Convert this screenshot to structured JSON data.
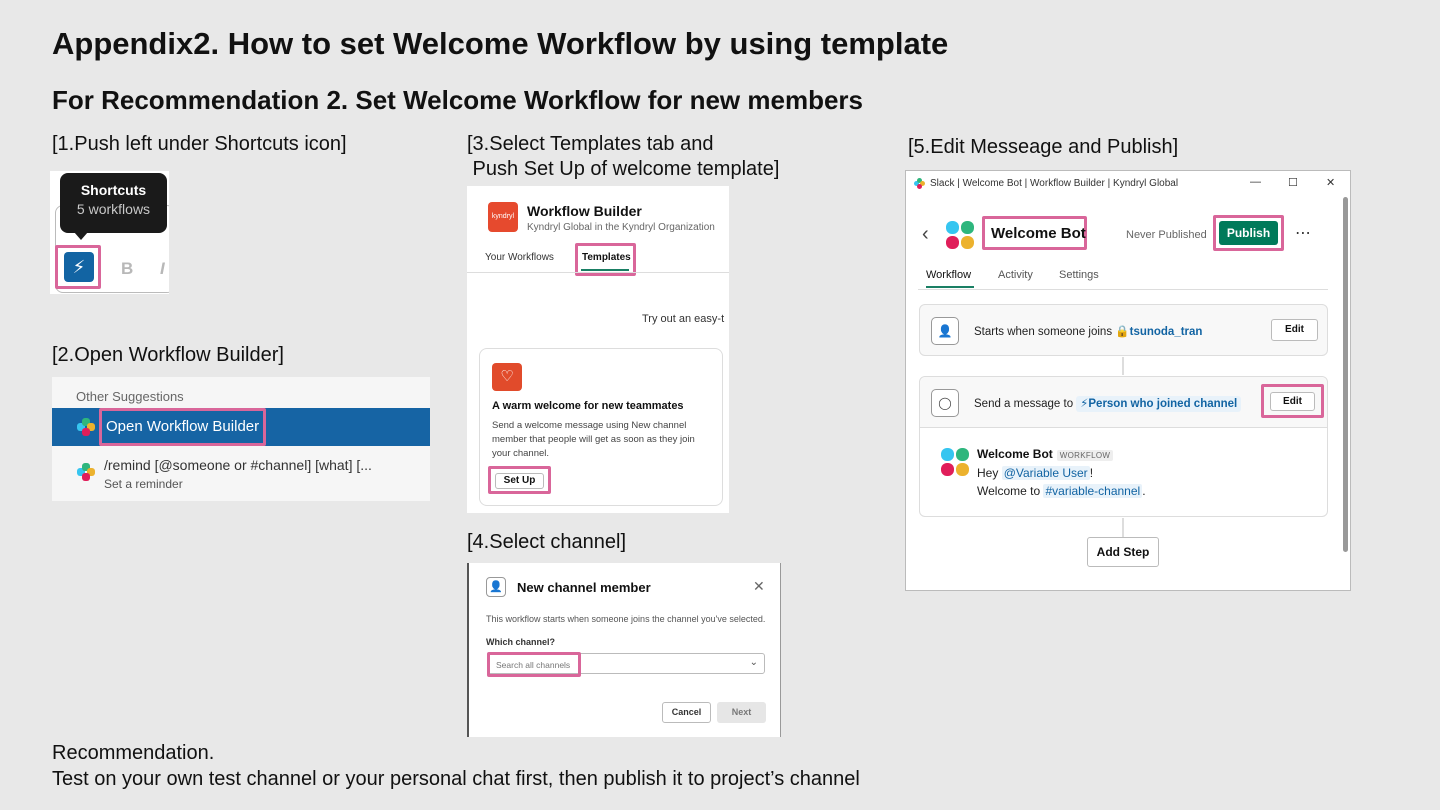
{
  "title": "Appendix2. How to set Welcome Workflow by using template",
  "subtitle": "For Recommendation 2. Set Welcome Workflow for new members",
  "steps": {
    "s1": "[1.Push left under Shortcuts icon]",
    "s2": "[2.Open Workflow Builder]",
    "s3_line1": "[3.Select Templates tab and",
    "s3_line2": " Push Set Up of welcome template]",
    "s4": "[4.Select channel]",
    "s5": "[5.Edit Messeage and Publish]"
  },
  "shot1": {
    "tooltip_title": "Shortcuts",
    "tooltip_sub": "5 workflows",
    "bold_glyph": "B",
    "italic_glyph": "I"
  },
  "shot2": {
    "section": "Other Suggestions",
    "item1": "Open Workflow Builder",
    "item2_cmd": "/remind [@someone or #channel] [what] [...",
    "item2_sub": "Set a reminder"
  },
  "shot3": {
    "logo_text": "kyndryl",
    "title": "Workflow Builder",
    "org": "Kyndryl Global in the Kyndryl Organization",
    "tab_your": "Your Workflows",
    "tab_templates": "Templates",
    "try_text": "Try out an easy-t",
    "card_title": "A warm welcome for new teammates",
    "card_desc": "Send a welcome message using New channel member that people will get as soon as they join your channel.",
    "setup": "Set Up"
  },
  "shot4": {
    "title": "New channel member",
    "desc": "This workflow starts when someone joins the channel you've selected.",
    "which": "Which channel?",
    "placeholder": "Search all channels",
    "cancel": "Cancel",
    "next": "Next"
  },
  "shot5": {
    "window_title": "Slack | Welcome Bot | Workflow Builder | Kyndryl Global",
    "name": "Welcome Bot",
    "status": "Never Published",
    "publish": "Publish",
    "tabs": [
      "Workflow",
      "Activity",
      "Settings"
    ],
    "trigger_text": "Starts when someone joins",
    "trigger_channel": "tsunoda_tran",
    "edit": "Edit",
    "send_text": "Send a message to",
    "send_target": "Person who joined channel",
    "msg_name": "Welcome Bot",
    "msg_badge": "WORKFLOW",
    "msg_line1_a": "Hey ",
    "msg_line1_var": "@Variable User",
    "msg_line1_b": "!",
    "msg_line2_a": "Welcome to ",
    "msg_line2_var": "#variable-channel",
    "msg_line2_b": ".",
    "add_step": "Add Step"
  },
  "footer": {
    "line1": "Recommendation.",
    "line2": "Test on your own test channel or your personal chat first, then publish it to project’s channel"
  },
  "colors": {
    "background": "#e8e8e8",
    "highlight": "#d9669a",
    "slack_blue": "#1264a3",
    "publish_green": "#007a5a",
    "kyndryl_red": "#e64a2e"
  }
}
